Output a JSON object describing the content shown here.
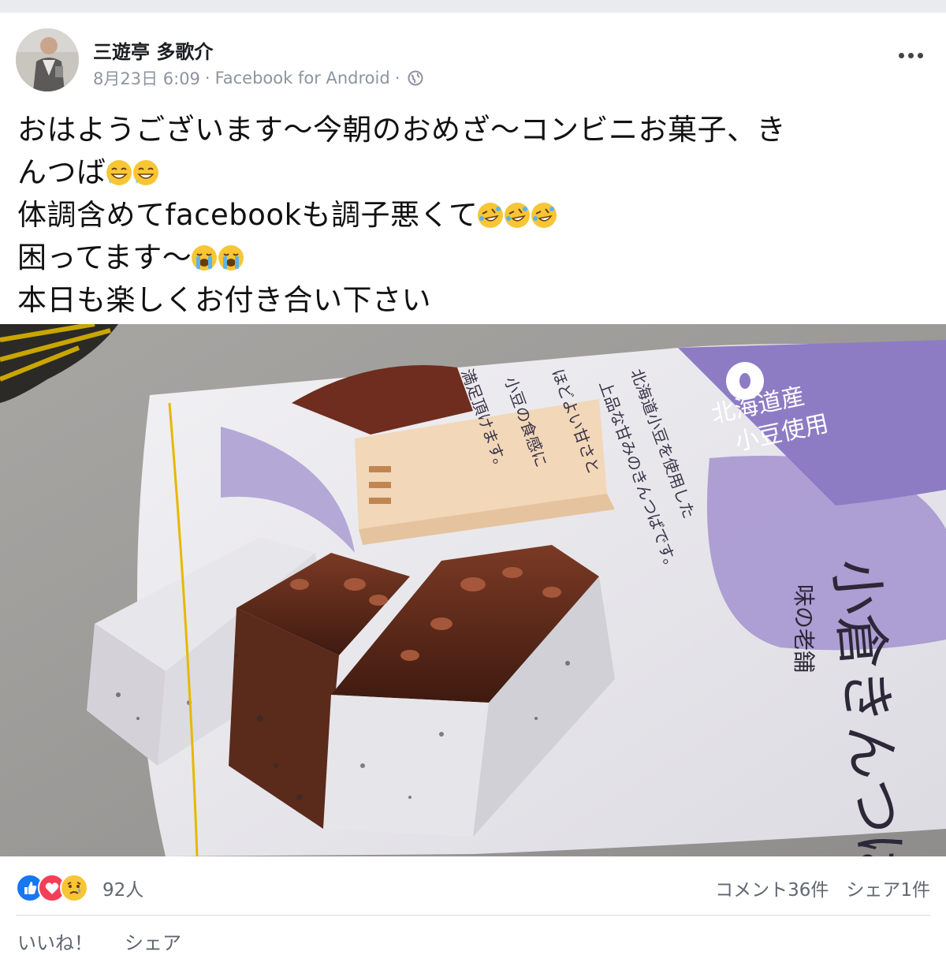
{
  "post": {
    "author": "三遊亭 多歌介",
    "date": "8月23日 6:09",
    "source": "Facebook for Android",
    "privacy_icon": "globe-icon",
    "text_lines": [
      {
        "text": "おはようございます〜今朝のおめざ〜コンビニお菓子、き",
        "emoji": null,
        "emoji_count": 0
      },
      {
        "text": "んつば",
        "emoji": "grinning-sweat-face",
        "emoji_count": 2
      },
      {
        "text": "体調含めてfacebookも調子悪くて",
        "emoji": "rolling-laughing-face",
        "emoji_count": 3
      },
      {
        "text": "困ってます〜",
        "emoji": "loudly-crying-face",
        "emoji_count": 2
      },
      {
        "text": "本日も楽しくお付き合い下さい",
        "emoji": null,
        "emoji_count": 0
      }
    ]
  },
  "photo": {
    "package_badge_lines": [
      "北海道産",
      "小豆使用"
    ],
    "package_text_lines": [
      "北海道小豆を使用した",
      "上品な甘みのきんつばです。",
      "ほどよい甘さと",
      "小豆の食感に",
      "満足頂けます。"
    ],
    "package_brand_small": "味の老舗",
    "package_title": "小倉きんつば"
  },
  "stats": {
    "reaction_icons": [
      "like-icon",
      "love-icon",
      "sad-icon"
    ],
    "reaction_count": "92人",
    "comments": "コメント36件",
    "shares": "シェア1件"
  },
  "actions": {
    "like": "いいね！",
    "share": "シェア"
  },
  "colors": {
    "like_blue": "#1877f2",
    "love_red": "#f33e58",
    "meta_gray": "#8d949e",
    "package_purple": "#8d7cc4"
  }
}
